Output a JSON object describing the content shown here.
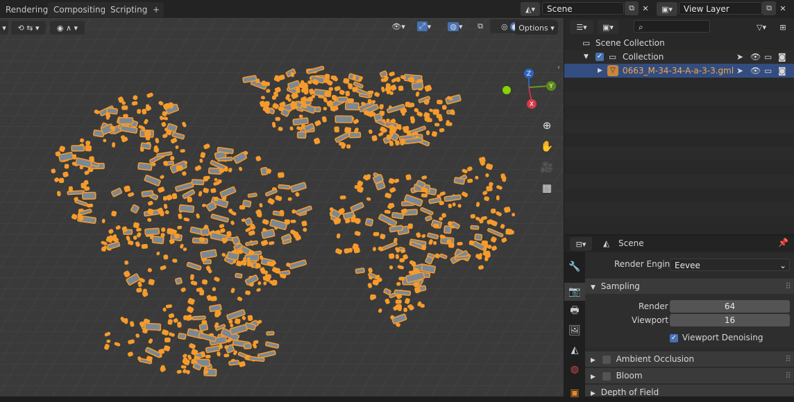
{
  "workspace_tabs": [
    "Rendering",
    "Compositing",
    "Scripting"
  ],
  "add_tab_label": "+",
  "scene_field": "Scene",
  "view_layer_field": "View Layer",
  "viewport": {
    "options_label": "Options",
    "gizmo_labels": {
      "z": "Z",
      "y": "Y",
      "x": "X"
    },
    "background_color": "#3a3a3a",
    "selection_color": "#f59b2c",
    "building_fill": "#7a8896"
  },
  "outliner": {
    "search_placeholder": "",
    "root_label": "Scene Collection",
    "collection_label": "Collection",
    "object_label": "0663_M-34-34-A-a-3-3.gml"
  },
  "properties": {
    "scene_label": "Scene",
    "render_engine_label": "Render Engine",
    "render_engine_value": "Eevee",
    "sampling_label": "Sampling",
    "render_label": "Render",
    "render_value": "64",
    "viewport_label": "Viewport",
    "viewport_value": "16",
    "denoise_label": "Viewport Denoising",
    "panels": [
      "Ambient Occlusion",
      "Bloom",
      "Depth of Field"
    ]
  }
}
